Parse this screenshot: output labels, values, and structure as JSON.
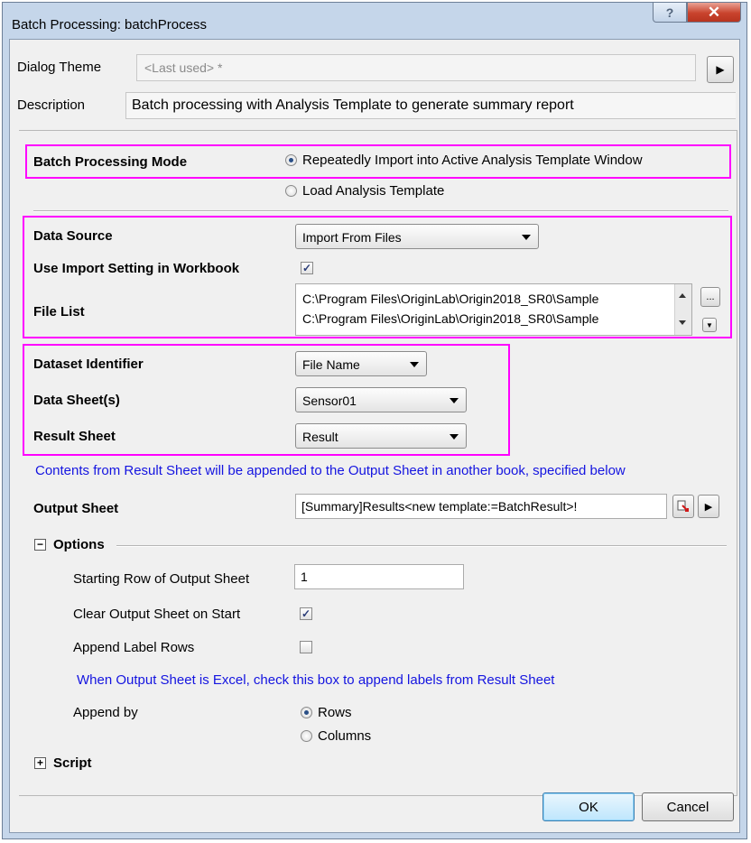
{
  "window": {
    "title": "Batch Processing: batchProcess",
    "help_label": "?",
    "close_label": "✕"
  },
  "dialog_theme": {
    "label": "Dialog Theme",
    "value": "<Last used> *",
    "arrow": "▶"
  },
  "description": {
    "label": "Description",
    "value": "Batch processing with Analysis Template to generate summary report"
  },
  "batch_mode": {
    "label": "Batch Processing Mode",
    "options": [
      "Repeatedly Import into Active Analysis Template Window",
      "Load Analysis Template"
    ],
    "selected_index": 0
  },
  "data_source": {
    "label": "Data Source",
    "value": "Import From Files"
  },
  "use_import_setting": {
    "label": "Use Import Setting in Workbook",
    "checked": true
  },
  "file_list": {
    "label": "File List",
    "files": [
      "C:\\Program Files\\OriginLab\\Origin2018_SR0\\Sample",
      "C:\\Program Files\\OriginLab\\Origin2018_SR0\\Sample"
    ],
    "browse_label": "..."
  },
  "dataset_identifier": {
    "label": "Dataset Identifier",
    "value": "File Name"
  },
  "data_sheets": {
    "label": "Data Sheet(s)",
    "value": "Sensor01"
  },
  "result_sheet": {
    "label": "Result Sheet",
    "value": "Result"
  },
  "info_text": "Contents from Result Sheet will be appended to the Output Sheet in another book, specified below",
  "output_sheet": {
    "label": "Output Sheet",
    "value": "[Summary]Results<new template:=BatchResult>!",
    "arrow": "▶"
  },
  "options": {
    "toggle": "−",
    "label": "Options",
    "starting_row": {
      "label": "Starting Row of Output Sheet",
      "value": "1"
    },
    "clear_output": {
      "label": "Clear Output Sheet on Start",
      "checked": true
    },
    "append_label_rows": {
      "label": "Append Label Rows",
      "checked": false
    },
    "excel_hint": "When Output Sheet is Excel, check this box to append labels from Result Sheet",
    "append_by": {
      "label": "Append by",
      "options": [
        "Rows",
        "Columns"
      ],
      "selected_index": 0
    }
  },
  "script": {
    "toggle": "+",
    "label": "Script"
  },
  "buttons": {
    "ok": "OK",
    "cancel": "Cancel"
  },
  "colors": {
    "highlight": "#ff00ff",
    "info_text": "#1414e0",
    "title_bar": "#c5d6ea"
  }
}
